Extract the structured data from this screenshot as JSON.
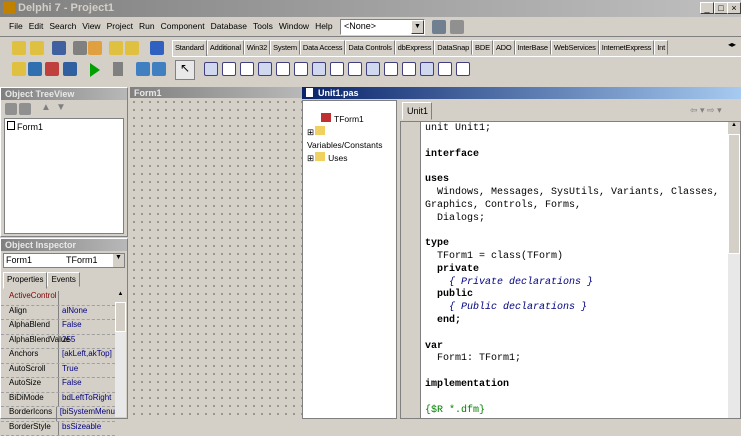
{
  "main_window": {
    "title": "Delphi 7 - Project1",
    "minimize": "_",
    "maximize": "□",
    "close": "×"
  },
  "menu": [
    "File",
    "Edit",
    "Search",
    "View",
    "Project",
    "Run",
    "Component",
    "Database",
    "Tools",
    "Window",
    "Help"
  ],
  "desktop_combo": {
    "value": "<None>"
  },
  "palette_tabs": [
    "Standard",
    "Additional",
    "Win32",
    "System",
    "Data Access",
    "Data Controls",
    "dbExpress",
    "DataSnap",
    "BDE",
    "ADO",
    "InterBase",
    "WebServices",
    "InternetExpress",
    "Int"
  ],
  "active_palette_tab": "Standard",
  "object_treeview": {
    "title": "Object TreeView",
    "items": [
      "Form1"
    ]
  },
  "object_inspector": {
    "title": "Object Inspector",
    "selected_object": "Form1",
    "selected_type": "TForm1",
    "tabs": [
      "Properties",
      "Events"
    ],
    "properties": [
      {
        "name": "ActiveControl",
        "value": ""
      },
      {
        "name": "Align",
        "value": "alNone"
      },
      {
        "name": "AlphaBlend",
        "value": "False"
      },
      {
        "name": "AlphaBlendValue",
        "value": "255"
      },
      {
        "name": "Anchors",
        "value": "[akLeft,akTop]"
      },
      {
        "name": "AutoScroll",
        "value": "True"
      },
      {
        "name": "AutoSize",
        "value": "False"
      },
      {
        "name": "BiDiMode",
        "value": "bdLeftToRight"
      },
      {
        "name": "BorderIcons",
        "value": "[biSystemMenu"
      },
      {
        "name": "BorderStyle",
        "value": "bsSizeable"
      }
    ]
  },
  "form_designer": {
    "title": "Form1"
  },
  "code_editor": {
    "title": "Unit1.pas",
    "tab": "Unit1",
    "explorer": [
      "TForm1",
      "Variables/Constants",
      "Uses"
    ],
    "lines": [
      {
        "t": "unit Unit1;",
        "c": "n"
      },
      {
        "t": "",
        "c": "n"
      },
      {
        "t": "interface",
        "c": "kw"
      },
      {
        "t": "",
        "c": "n"
      },
      {
        "t": "uses",
        "c": "kw"
      },
      {
        "t": "  Windows, Messages, SysUtils, Variants, Classes, Graphics, Controls, Forms,",
        "c": "n"
      },
      {
        "t": "  Dialogs;",
        "c": "n"
      },
      {
        "t": "",
        "c": "n"
      },
      {
        "t": "type",
        "c": "kw"
      },
      {
        "t": "  TForm1 = class(TForm)",
        "c": "n"
      },
      {
        "t": "  private",
        "c": "kw"
      },
      {
        "t": "    { Private declarations }",
        "c": "cm"
      },
      {
        "t": "  public",
        "c": "kw"
      },
      {
        "t": "    { Public declarations }",
        "c": "cm"
      },
      {
        "t": "  end;",
        "c": "kw"
      },
      {
        "t": "",
        "c": "n"
      },
      {
        "t": "var",
        "c": "kw"
      },
      {
        "t": "  Form1: TForm1;",
        "c": "n"
      },
      {
        "t": "",
        "c": "n"
      },
      {
        "t": "implementation",
        "c": "kw"
      },
      {
        "t": "",
        "c": "n"
      },
      {
        "t": "{$R *.dfm}",
        "c": "dir"
      }
    ]
  }
}
